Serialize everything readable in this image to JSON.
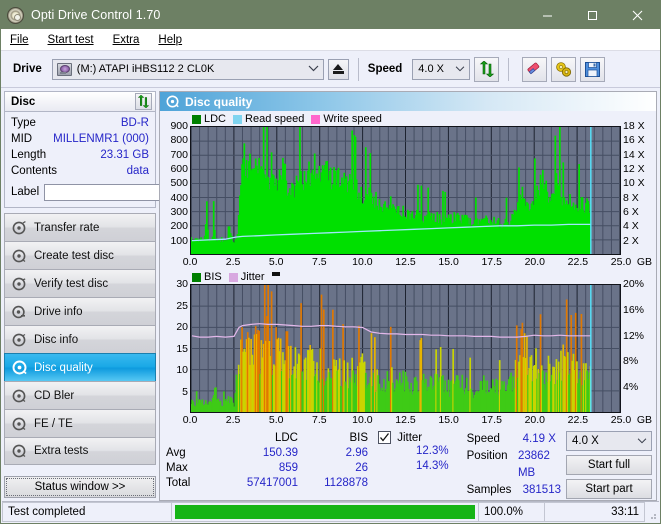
{
  "window": {
    "title": "Opti Drive Control 1.70",
    "icon": "disc-icon",
    "minimize": "minimize-icon",
    "maximize": "maximize-icon",
    "close": "close-icon"
  },
  "menu": {
    "items": [
      "File",
      "Start test",
      "Extra",
      "Help"
    ]
  },
  "toolbar": {
    "drive_label": "Drive",
    "drive_value": "(M:)  ATAPI iHBS112  2 CL0K",
    "eject": "eject-icon",
    "speed_label": "Speed",
    "speed_value": "4.0 X",
    "refresh": "refresh-icon",
    "erase": "eraser-icon",
    "settings": "gears-icon",
    "save": "save-icon"
  },
  "disc": {
    "title": "Disc",
    "refresh": "refresh-icon",
    "rows": [
      {
        "key": "Type",
        "value": "BD-R"
      },
      {
        "key": "MID",
        "value": "MILLENMR1 (000)"
      },
      {
        "key": "Length",
        "value": "23.31 GB"
      },
      {
        "key": "Contents",
        "value": "data"
      }
    ],
    "label_key": "Label",
    "label_value": "",
    "label_placeholder": ""
  },
  "sidebar": {
    "items": [
      {
        "label": "Transfer rate",
        "icon": "disc-icon",
        "active": false
      },
      {
        "label": "Create test disc",
        "icon": "disc-icon",
        "active": false
      },
      {
        "label": "Verify test disc",
        "icon": "disc-icon",
        "active": false
      },
      {
        "label": "Drive info",
        "icon": "disc-icon",
        "active": false
      },
      {
        "label": "Disc info",
        "icon": "disc-icon",
        "active": false
      },
      {
        "label": "Disc quality",
        "icon": "disc-icon",
        "active": true
      },
      {
        "label": "CD Bler",
        "icon": "disc-icon",
        "active": false
      },
      {
        "label": "FE / TE",
        "icon": "disc-icon",
        "active": false
      },
      {
        "label": "Extra tests",
        "icon": "disc-icon",
        "active": false
      }
    ],
    "status_window": "Status window >>"
  },
  "main": {
    "title": "Disc quality",
    "title_icon": "disc-icon"
  },
  "stats": {
    "col_headers": [
      "",
      "LDC",
      "BIS"
    ],
    "rows": [
      {
        "label": "Avg",
        "ldc": "150.39",
        "bis": "2.96"
      },
      {
        "label": "Max",
        "ldc": "859",
        "bis": "26"
      },
      {
        "label": "Total",
        "ldc": "57417001",
        "bis": "1128878"
      }
    ],
    "jitter_label": "Jitter",
    "jitter_checked": true,
    "jitter_avg": "12.3%",
    "jitter_max": "14.3%",
    "speed_key": "Speed",
    "speed_value": "4.19 X",
    "position_key": "Position",
    "position_value": "23862 MB",
    "samples_key": "Samples",
    "samples_value": "381513",
    "speed_select": "4.0 X",
    "start_full": "Start full",
    "start_part": "Start part"
  },
  "statusbar": {
    "message": "Test completed",
    "progress_pct": "100.0%",
    "progress_value": 100,
    "elapsed": "33:11"
  },
  "colors": {
    "ldc": "#00e000",
    "bis": "#00c000",
    "read_speed": "#7fdfff",
    "write_speed": "#ff66cc",
    "jitter": "#e0b0e8",
    "plot_bg": "#6a7389",
    "titlebar": "#6d8064",
    "accent": "#2626c8"
  },
  "chart_data": [
    {
      "type": "area",
      "id": "ldc-chart",
      "title": "Disc quality",
      "legend": [
        {
          "name": "LDC",
          "color": "#008000"
        },
        {
          "name": "Read speed",
          "color": "#7fd4f0"
        },
        {
          "name": "Write speed",
          "color": "#ff66cc"
        }
      ],
      "legend_position": "top-left",
      "xlabel": "GB",
      "x_unit": "GB",
      "xlim": [
        0,
        25
      ],
      "xticks": [
        0.0,
        2.5,
        5.0,
        7.5,
        10.0,
        12.5,
        15.0,
        17.5,
        20.0,
        22.5,
        25.0
      ],
      "xticklabels": [
        "0.0",
        "2.5",
        "5.0",
        "7.5",
        "10.0",
        "12.5",
        "15.0",
        "17.5",
        "20.0",
        "22.5",
        "25.0"
      ],
      "ylabel": "LDC",
      "ylim": [
        0,
        900
      ],
      "yticks": [
        100,
        200,
        300,
        400,
        500,
        600,
        700,
        800,
        900
      ],
      "y2label": "Speed",
      "y2lim": [
        0,
        18
      ],
      "y2ticks": [
        2,
        4,
        6,
        8,
        10,
        12,
        14,
        16,
        18
      ],
      "y2ticklabels": [
        "2 X",
        "4 X",
        "6 X",
        "8 X",
        "10 X",
        "12 X",
        "14 X",
        "16 X",
        "18 X"
      ],
      "grid": true,
      "data_end_gb": 23.3,
      "marker_gb": 23.3,
      "series": [
        {
          "name": "LDC",
          "color": "#00e000",
          "x": [
            0.05,
            0.15,
            0.3,
            0.45,
            0.6,
            0.75,
            0.9,
            1.05,
            1.2,
            1.35,
            1.5,
            1.65,
            1.8,
            1.95,
            2.1,
            2.25,
            2.4,
            2.55,
            2.7,
            2.8,
            2.9,
            3.0,
            3.1,
            3.2,
            3.3,
            3.4,
            3.5,
            3.6,
            3.7,
            3.8,
            3.9,
            4.0,
            4.1,
            4.2,
            4.3,
            4.4,
            4.5,
            4.6,
            4.7,
            4.8,
            4.9,
            5.0,
            5.2,
            5.4,
            5.6,
            5.8,
            6.0,
            6.2,
            6.4,
            6.6,
            6.8,
            7.0,
            7.2,
            7.4,
            7.6,
            7.8,
            8.0,
            8.2,
            8.4,
            8.6,
            8.8,
            9.0,
            9.2,
            9.4,
            9.6,
            9.8,
            10.0,
            10.3,
            10.6,
            10.9,
            11.2,
            11.5,
            11.8,
            12.1,
            12.4,
            12.7,
            13.0,
            13.4,
            13.8,
            14.2,
            14.6,
            15.0,
            15.4,
            15.8,
            16.2,
            16.6,
            17.0,
            17.4,
            17.8,
            18.2,
            18.6,
            19.0,
            19.3,
            19.6,
            19.9,
            20.2,
            20.5,
            20.8,
            21.1,
            21.4,
            21.7,
            22.0,
            22.3,
            22.6,
            22.9,
            23.2
          ],
          "y": [
            120,
            115,
            110,
            105,
            118,
            100,
            260,
            110,
            105,
            260,
            100,
            110,
            115,
            105,
            110,
            260,
            105,
            100,
            110,
            350,
            560,
            700,
            790,
            720,
            660,
            700,
            740,
            680,
            720,
            855,
            700,
            640,
            600,
            620,
            580,
            600,
            560,
            620,
            700,
            640,
            580,
            560,
            620,
            700,
            560,
            480,
            520,
            640,
            580,
            600,
            620,
            660,
            700,
            640,
            600,
            680,
            640,
            600,
            660,
            620,
            580,
            600,
            560,
            540,
            520,
            500,
            480,
            460,
            440,
            420,
            400,
            430,
            380,
            360,
            340,
            320,
            310,
            300,
            290,
            300,
            280,
            270,
            290,
            280,
            260,
            250,
            270,
            260,
            250,
            240,
            260,
            330,
            480,
            420,
            380,
            480,
            600,
            500,
            420,
            660,
            400,
            420,
            380,
            400,
            390,
            380
          ]
        },
        {
          "name": "Read speed",
          "color": "#7fdfff",
          "x": [
            0.05,
            1.0,
            2.0,
            2.6,
            3.0,
            4.0,
            5.0,
            6.0,
            7.0,
            8.0,
            9.0,
            10.0,
            11.0,
            12.0,
            13.0,
            14.0,
            15.0,
            16.0,
            17.0,
            18.0,
            19.0,
            20.0,
            21.0,
            22.0,
            23.0,
            23.3
          ],
          "y_speed_x": [
            1.9,
            2.0,
            2.1,
            2.4,
            2.5,
            2.6,
            2.7,
            2.8,
            2.9,
            3.0,
            3.1,
            3.2,
            3.3,
            3.4,
            3.5,
            3.6,
            3.7,
            3.8,
            3.9,
            4.0,
            4.0,
            4.1,
            4.1,
            4.2,
            4.2,
            4.2
          ]
        }
      ]
    },
    {
      "type": "area",
      "id": "bis-chart",
      "legend": [
        {
          "name": "BIS",
          "color": "#008000"
        },
        {
          "name": "Jitter",
          "color": "#d8a8e0"
        }
      ],
      "legend_position": "top-left",
      "xlabel": "GB",
      "x_unit": "GB",
      "xlim": [
        0,
        25
      ],
      "xticks": [
        0.0,
        2.5,
        5.0,
        7.5,
        10.0,
        12.5,
        15.0,
        17.5,
        20.0,
        22.5,
        25.0
      ],
      "xticklabels": [
        "0.0",
        "2.5",
        "5.0",
        "7.5",
        "10.0",
        "12.5",
        "15.0",
        "17.5",
        "20.0",
        "22.5",
        "25.0"
      ],
      "ylabel": "BIS",
      "ylim": [
        0,
        30
      ],
      "yticks": [
        5,
        10,
        15,
        20,
        25,
        30
      ],
      "y2label": "Jitter",
      "y2lim": [
        0,
        20
      ],
      "y2ticks": [
        4,
        8,
        12,
        16,
        20
      ],
      "y2ticklabels": [
        "4%",
        "8%",
        "12%",
        "16%",
        "20%"
      ],
      "grid": true,
      "data_end_gb": 23.3,
      "marker_gb": 23.3,
      "series": [
        {
          "name": "BIS",
          "color": "#c8c800",
          "x": [
            0.05,
            0.2,
            0.4,
            0.6,
            0.8,
            1.0,
            1.2,
            1.4,
            1.6,
            1.8,
            2.0,
            2.2,
            2.4,
            2.6,
            2.8,
            3.0,
            3.2,
            3.4,
            3.6,
            3.8,
            4.0,
            4.2,
            4.4,
            4.6,
            4.8,
            5.0,
            5.2,
            5.4,
            5.6,
            5.8,
            6.0,
            6.2,
            6.4,
            6.6,
            6.8,
            7.0,
            7.2,
            7.4,
            7.6,
            7.8,
            8.0,
            8.2,
            8.4,
            8.6,
            8.8,
            9.0,
            9.2,
            9.4,
            9.6,
            9.8,
            10.0,
            10.4,
            10.8,
            11.2,
            11.6,
            12.0,
            12.4,
            12.8,
            13.2,
            13.6,
            14.0,
            14.5,
            15.0,
            15.5,
            16.0,
            16.5,
            17.0,
            17.5,
            18.0,
            18.5,
            19.0,
            19.4,
            19.8,
            20.2,
            20.6,
            21.0,
            21.4,
            21.8,
            22.2,
            22.6,
            23.0,
            23.3
          ],
          "y": [
            3,
            2.5,
            3,
            4,
            3,
            2.5,
            3,
            6.5,
            3,
            2.5,
            3,
            4,
            3,
            2.5,
            14,
            20,
            26,
            22,
            18,
            24,
            20,
            16,
            22,
            18,
            15,
            20,
            17,
            14,
            19,
            16,
            13,
            18,
            15,
            12,
            17,
            24,
            14,
            11,
            16,
            13,
            10,
            15,
            12,
            16,
            11,
            14,
            10,
            13,
            9,
            12,
            13,
            11,
            10,
            9,
            12,
            8,
            10,
            7,
            9,
            11,
            8,
            9,
            7,
            10,
            8,
            7,
            9,
            8,
            7,
            9,
            12,
            22,
            13,
            15,
            11,
            14,
            12,
            16,
            13,
            14,
            12,
            13
          ]
        },
        {
          "name": "Jitter",
          "color": "#e0b0e8",
          "x": [
            0.05,
            0.5,
            1.0,
            1.5,
            2.0,
            2.5,
            2.8,
            3.0,
            3.5,
            4.0,
            4.5,
            5.0,
            5.5,
            6.0,
            6.5,
            7.0,
            7.5,
            8.0,
            8.5,
            9.0,
            9.5,
            10.0,
            10.5,
            11.0,
            11.5,
            12.0,
            12.5,
            13.0,
            13.5,
            14.0,
            14.5,
            15.0,
            15.5,
            16.0,
            16.5,
            17.0,
            17.5,
            18.0,
            18.5,
            19.0,
            19.5,
            20.0,
            20.5,
            21.0,
            21.5,
            22.0,
            22.5,
            23.0,
            23.3
          ],
          "y_pct": [
            12.0,
            11.8,
            11.8,
            11.9,
            11.8,
            11.9,
            13.3,
            13.6,
            13.8,
            13.9,
            13.8,
            13.8,
            13.7,
            13.6,
            13.5,
            13.5,
            13.6,
            13.6,
            13.5,
            13.4,
            13.4,
            13.3,
            12.6,
            12.4,
            12.3,
            12.3,
            12.2,
            12.2,
            12.2,
            12.1,
            12.1,
            12.0,
            12.0,
            12.0,
            11.9,
            11.9,
            11.9,
            11.8,
            11.8,
            11.8,
            11.9,
            12.1,
            12.0,
            12.0,
            12.1,
            12.0,
            12.0,
            12.0,
            12.0
          ]
        }
      ]
    }
  ]
}
